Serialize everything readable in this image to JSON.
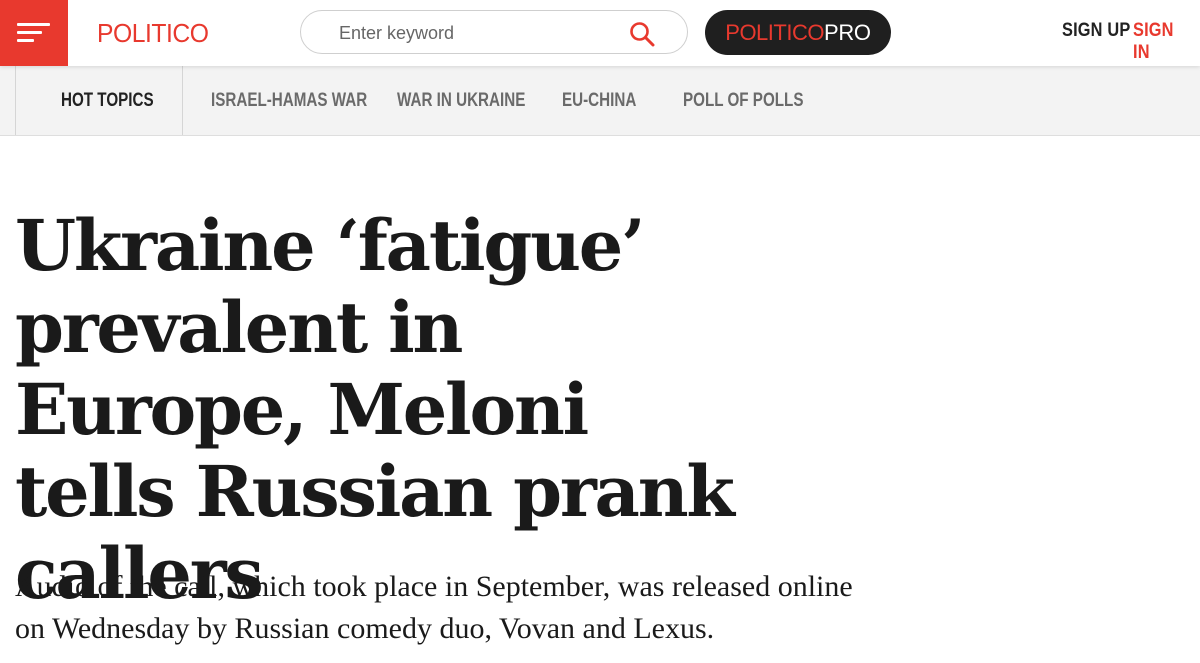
{
  "header": {
    "logo_text": "POLITICO",
    "search": {
      "placeholder": "Enter keyword",
      "value": ""
    },
    "pro": {
      "part1": "POLITICO",
      "part2": "PRO"
    },
    "sign_up": "SIGN UP",
    "sign_in": "SIGN IN",
    "colors": {
      "brand_red": "#e8392e",
      "dark": "#1f1f1f"
    }
  },
  "topics": {
    "label": "HOT TOPICS",
    "items": [
      {
        "label": "ISRAEL-HAMAS WAR"
      },
      {
        "label": "WAR IN UKRAINE"
      },
      {
        "label": "EU-CHINA"
      },
      {
        "label": "POLL OF POLLS"
      }
    ]
  },
  "article": {
    "headline": "Ukraine ‘fatigue’ prevalent in Europe, Meloni tells Russian prank callers",
    "dek": "Audio of the call, which took place in September, was released online on Wednesday by Russian comedy duo, Vovan and Lexus."
  },
  "icons": {
    "menu": "hamburger-menu-icon",
    "search": "search-icon"
  }
}
